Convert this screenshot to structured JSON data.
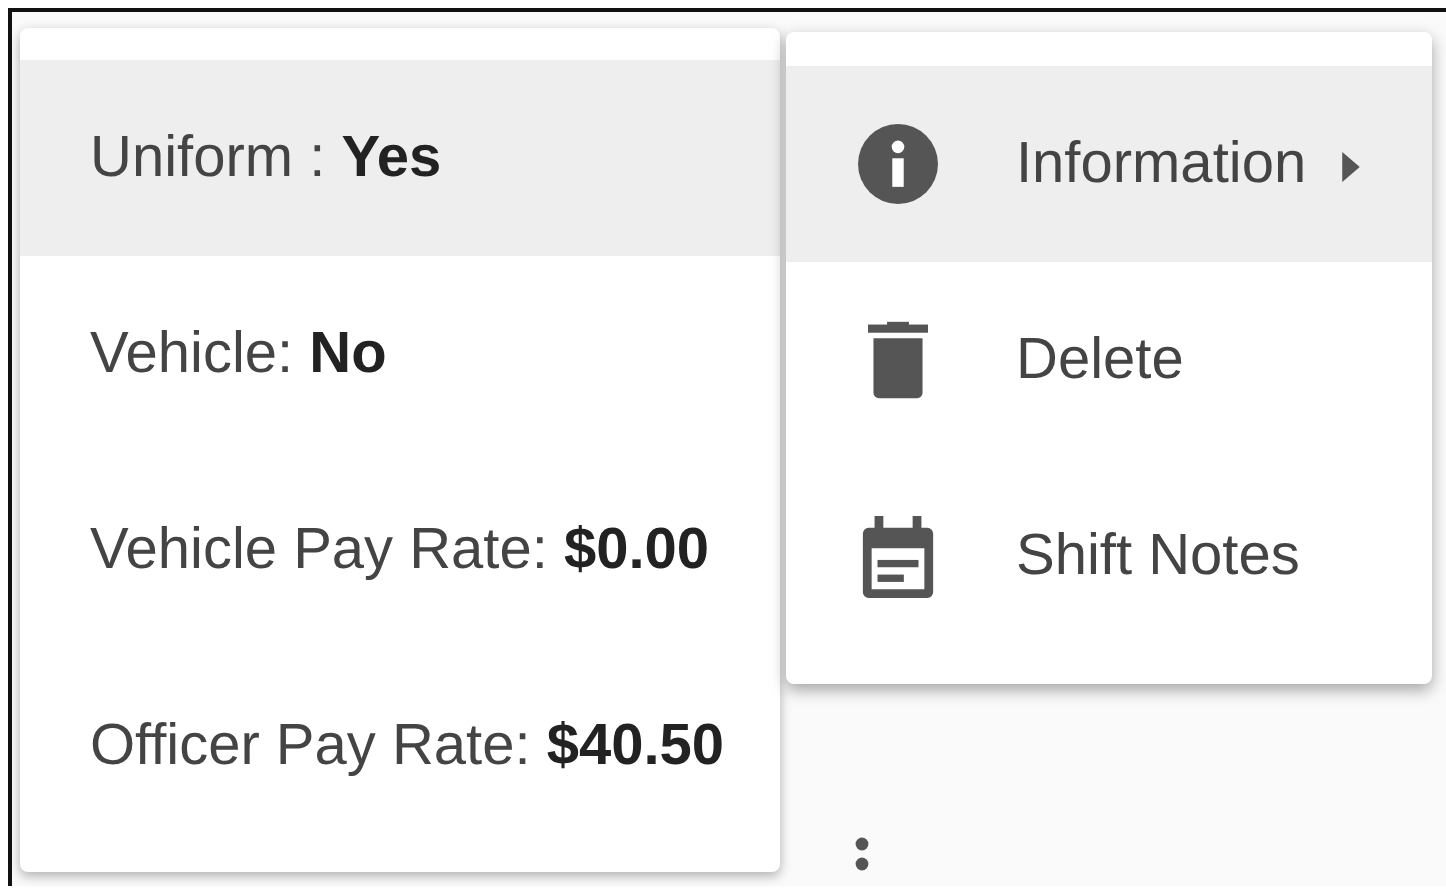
{
  "info_menu": {
    "items": [
      {
        "text": "Uniform : **Yes**",
        "highlighted": true
      },
      {
        "text": "Vehicle: **No**",
        "highlighted": false
      },
      {
        "text": "Vehicle Pay Rate: **$0.00**",
        "highlighted": false
      },
      {
        "text": "Officer Pay Rate: **$40.50**",
        "highlighted": false
      }
    ]
  },
  "action_menu": {
    "items": [
      {
        "kind": "info",
        "label": "Information",
        "highlighted": true,
        "submenu": true
      },
      {
        "kind": "trash",
        "label": "Delete",
        "highlighted": false,
        "submenu": false
      },
      {
        "kind": "calendar",
        "label": "Shift Notes",
        "highlighted": false,
        "submenu": false
      }
    ]
  }
}
